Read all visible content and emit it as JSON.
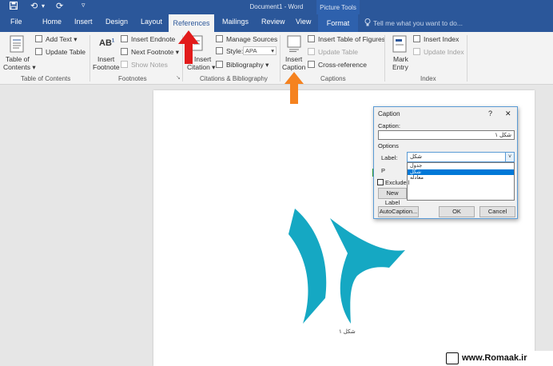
{
  "window": {
    "title": "Document1 - Word",
    "context_group": "Picture Tools"
  },
  "quick_access": {
    "save_icon": "save-icon",
    "undo_icon": "undo-icon",
    "redo_icon": "redo-icon",
    "customize_icon": "customize-icon",
    "undo_glyph": "⟲",
    "undo_drop": "▾",
    "redo_glyph": "⟳",
    "customize_glyph": "▿"
  },
  "tabs": [
    "File",
    "Home",
    "Insert",
    "Design",
    "Layout",
    "References",
    "Mailings",
    "Review",
    "View",
    "Format"
  ],
  "tell_me": "Tell me what you want to do...",
  "ribbon": {
    "toc": {
      "big": "Table of\nContents",
      "big1": "Table of",
      "big2": "Contents ▾",
      "add_text": "Add Text ▾",
      "update_table": "Update Table",
      "group": "Table of Contents"
    },
    "footnotes": {
      "insert_footnote1": "Insert",
      "insert_footnote2": "Footnote",
      "ab_glyph": "AB",
      "ab_sup": "1",
      "insert_endnote": "Insert Endnote",
      "next_footnote": "Next Footnote ▾",
      "show_notes": "Show Notes",
      "group": "Footnotes",
      "launcher": "↘"
    },
    "citations": {
      "insert_citation1": "Insert",
      "insert_citation2": "Citation ▾",
      "manage_sources": "Manage Sources",
      "style_label": "Style:",
      "style_value": "APA",
      "style_arrow": "▾",
      "bibliography": "Bibliography ▾",
      "group": "Citations & Bibliography"
    },
    "captions": {
      "insert_caption1": "Insert",
      "insert_caption2": "Caption",
      "insert_tof": "Insert Table of Figures",
      "update_table": "Update Table",
      "cross_reference": "Cross-reference",
      "group": "Captions"
    },
    "index": {
      "mark_entry1": "Mark",
      "mark_entry2": "Entry",
      "insert_index": "Insert Index",
      "update_index": "Update Index",
      "group": "Index"
    }
  },
  "document": {
    "figure_caption": "شکل ۱"
  },
  "dialog": {
    "title": "Caption",
    "help": "?",
    "close": "✕",
    "caption_label": "Caption:",
    "caption_value": "شکل ۱",
    "options_label": "Options",
    "label_label": "Label:",
    "label_value": "شکل",
    "label_options": [
      "جدول",
      "شکل",
      "معادله"
    ],
    "selected_option": "شکل",
    "position_partial": "P",
    "exclude_label": "Exclude l",
    "new_label_btn": "New Label",
    "autocaption_btn": "AutoCaption...",
    "ok_btn": "OK",
    "cancel_btn": "Cancel"
  },
  "annotations": {
    "red_arrow_color": "#e21b1b",
    "orange_arrow_color": "#f5821f",
    "green_arrow_color": "#3aa935"
  },
  "colors": {
    "ribbon_blue": "#2b579a",
    "figure_teal": "#15a8c3"
  },
  "watermark": {
    "site": "www.Romaak.ir"
  }
}
